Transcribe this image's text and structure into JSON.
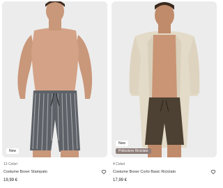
{
  "products": [
    {
      "badges": [
        "New"
      ],
      "colors": "13 Colori",
      "name": "Costume Boxer Stampato",
      "price": "19,99 €",
      "icons": {
        "wishlist": "heart-icon"
      },
      "colors_hex": {
        "background": "#ececec",
        "shorts": "#5e6268"
      }
    },
    {
      "badges": [
        "New",
        "Poliestere Riciclato"
      ],
      "colors": "4 Colori",
      "name": "Costume Boxer Corto Basic Riciclato",
      "price": "17,99 €",
      "icons": {
        "wishlist": "heart-icon"
      },
      "colors_hex": {
        "background": "#ececec",
        "shorts": "#4d4133",
        "shirt": "#e3dac7"
      }
    }
  ]
}
